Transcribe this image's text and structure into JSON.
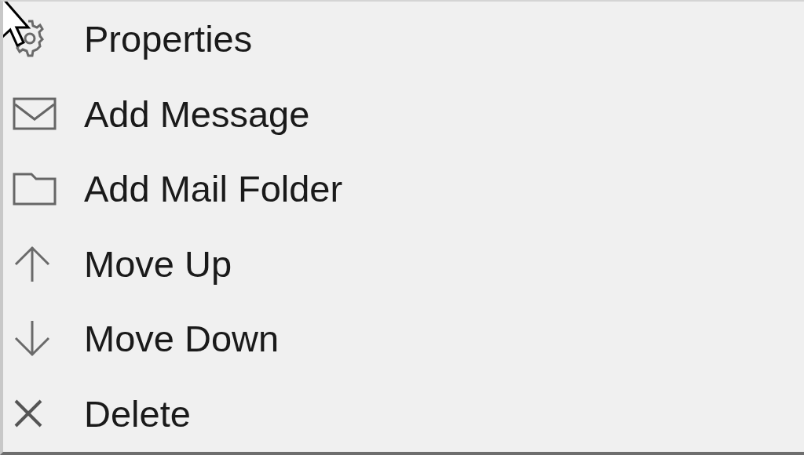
{
  "menu": {
    "items": [
      {
        "kind": "gear",
        "label": "Properties"
      },
      {
        "kind": "mail",
        "label": "Add Message"
      },
      {
        "kind": "folder",
        "label": "Add Mail Folder"
      },
      {
        "kind": "up",
        "label": "Move Up"
      },
      {
        "kind": "down",
        "label": "Move Down"
      },
      {
        "kind": "delete",
        "label": "Delete"
      }
    ]
  }
}
